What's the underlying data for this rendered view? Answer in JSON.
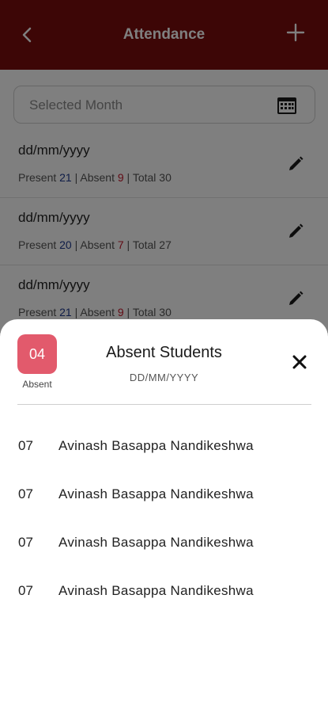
{
  "app_bar": {
    "title": "Attendance",
    "back_icon": "arrow-left-icon",
    "add_icon": "plus-icon",
    "color": "#7a0c0c"
  },
  "month_field": {
    "placeholder": "Selected Month",
    "icon": "calendar-icon"
  },
  "attendance_records": [
    {
      "date": "dd/mm/yyyy",
      "present_label": "Present",
      "present": "21",
      "absent_label": "Absent",
      "absent": "9",
      "total_label": "Total",
      "total": "30"
    },
    {
      "date": "dd/mm/yyyy",
      "present_label": "Present",
      "present": "20",
      "absent_label": "Absent",
      "absent": "7",
      "total_label": "Total",
      "total": "27"
    },
    {
      "date": "dd/mm/yyyy",
      "present_label": "Present",
      "present": "21",
      "absent_label": "Absent",
      "absent": "9",
      "total_label": "Total",
      "total": "30"
    }
  ],
  "sheet": {
    "badge_count": "04",
    "badge_label": "Absent",
    "badge_color": "#e25a6c",
    "title": "Absent Students",
    "date": "DD/MM/YYYY",
    "close_icon": "close-icon",
    "students": [
      {
        "roll": "07",
        "name": "Avinash Basappa Nandikeshwa"
      },
      {
        "roll": "07",
        "name": "Avinash Basappa Nandikeshwa"
      },
      {
        "roll": "07",
        "name": "Avinash Basappa Nandikeshwa"
      },
      {
        "roll": "07",
        "name": "Avinash Basappa Nandikeshwa"
      }
    ]
  }
}
